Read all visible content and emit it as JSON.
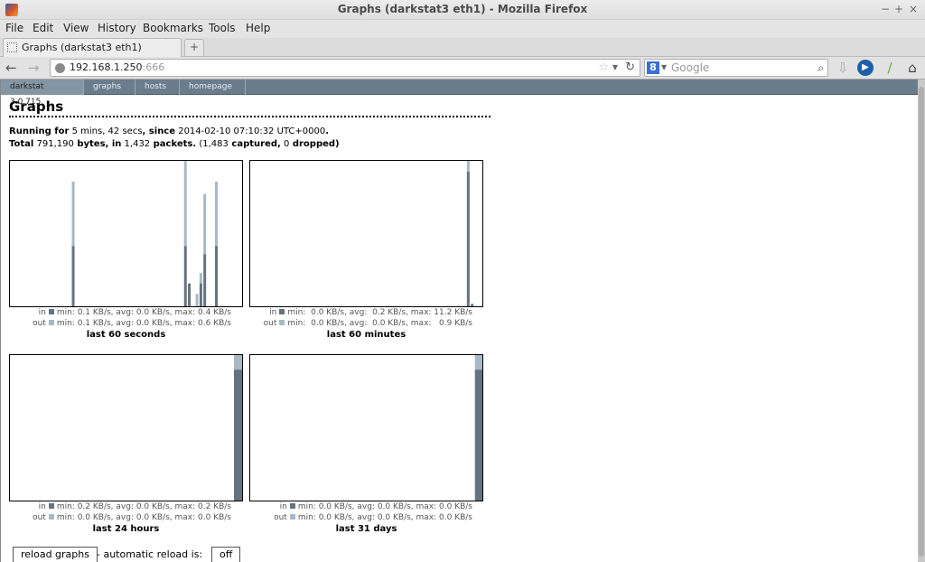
{
  "window": {
    "title": "Graphs (darkstat3 eth1) - Mozilla Firefox",
    "controls": [
      "−",
      "+",
      "×"
    ]
  },
  "menu": [
    "File",
    "Edit",
    "View",
    "History",
    "Bookmarks",
    "Tools",
    "Help"
  ],
  "tab": {
    "label": "Graphs (darkstat3 eth1)",
    "new_tab": "+"
  },
  "navbar": {
    "url_host": "192.168.1.250",
    "url_port": ":666",
    "search_placeholder": "Google",
    "search_engine_letter": "8"
  },
  "site": {
    "nav": [
      "darkstat 3.0.715",
      "graphs",
      "hosts",
      "homepage"
    ],
    "heading": "Graphs",
    "running": {
      "l1": "Running for",
      "v1": " 5 mins, 42 secs",
      "l2": ", since",
      "v2": " 2014-02-10 07:10:32 UTC+0000",
      "l3": "."
    },
    "total": {
      "l1": "Total",
      "v1": " 791,190",
      "l2": " bytes, in",
      "v2": " 1,432",
      "l3": " packets.",
      "v3": " (1,483",
      "l4": " captured,",
      "v4": " 0",
      "l5": " dropped)"
    },
    "reload_button": "reload graphs",
    "reload_text": "- automatic reload is:",
    "auto_reload_button": "off"
  },
  "colors": {
    "in": "#66737f",
    "out": "#a8b8c4",
    "nav": "#6b7d8c"
  },
  "chart_data": [
    {
      "type": "bar",
      "stacked": true,
      "title": "last 60 seconds",
      "slots": 60,
      "scale_max": 0.7,
      "legend_in": "in",
      "legend_out": "out",
      "stats_in": "min: 0.1 KB/s, avg: 0.0 KB/s, max: 0.4 KB/s",
      "stats_out": "min: 0.1 KB/s, avg: 0.0 KB/s, max: 0.6 KB/s",
      "bars": [
        {
          "slot": 16,
          "in": 0.29,
          "out": 0.31
        },
        {
          "slot": 45,
          "in": 0.29,
          "out": 0.41
        },
        {
          "slot": 46,
          "in": 0.11,
          "out": 0.0
        },
        {
          "slot": 48,
          "in": 0.0,
          "out": 0.06
        },
        {
          "slot": 49,
          "in": 0.11,
          "out": 0.05
        },
        {
          "slot": 50,
          "in": 0.25,
          "out": 0.29
        },
        {
          "slot": 53,
          "in": 0.29,
          "out": 0.31
        }
      ]
    },
    {
      "type": "bar",
      "stacked": true,
      "title": "last 60 minutes",
      "slots": 60,
      "scale_max": 12.1,
      "legend_in": "in",
      "legend_out": "out",
      "stats_in": "min:  0.0 KB/s, avg:  0.2 KB/s, max: 11.2 KB/s",
      "stats_out": "min:  0.0 KB/s, avg:  0.0 KB/s, max:   0.9 KB/s",
      "bars": [
        {
          "slot": 56,
          "in": 11.2,
          "out": 0.9
        },
        {
          "slot": 57,
          "in": 0.2,
          "out": 0.0
        }
      ]
    },
    {
      "type": "bar",
      "stacked": true,
      "title": "last 24 hours",
      "slots": 24,
      "scale_max": 1.0,
      "legend_in": "in",
      "legend_out": "out",
      "stats_in": "min: 0.2 KB/s, avg: 0.0 KB/s, max: 0.2 KB/s",
      "stats_out": "min: 0.0 KB/s, avg: 0.0 KB/s, max: 0.0 KB/s",
      "bars": [
        {
          "slot": 23,
          "in": 0.9,
          "out": 0.1
        }
      ]
    },
    {
      "type": "bar",
      "stacked": true,
      "title": "last 31 days",
      "slots": 31,
      "scale_max": 1.0,
      "legend_in": "in",
      "legend_out": "out",
      "stats_in": "min: 0.0 KB/s, avg: 0.0 KB/s, max: 0.0 KB/s",
      "stats_out": "min: 0.0 KB/s, avg: 0.0 KB/s, max: 0.0 KB/s",
      "bars": [
        {
          "slot": 30,
          "in": 0.9,
          "out": 0.1
        }
      ]
    }
  ]
}
